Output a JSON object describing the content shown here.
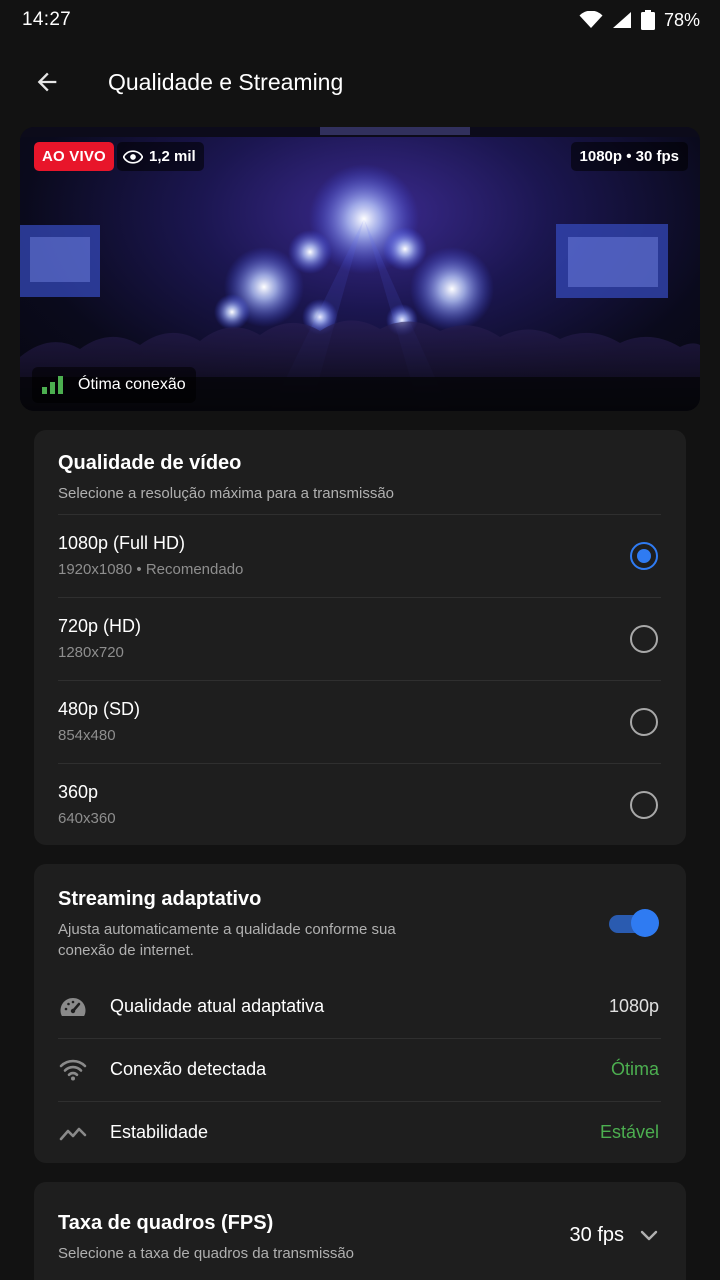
{
  "status": {
    "time": "14:27",
    "battery": "78%"
  },
  "appbar": {
    "title": "Qualidade e Streaming"
  },
  "hero": {
    "live_label": "AO VIVO",
    "viewers": "1,2 mil",
    "resolution": "1080p • 30 fps",
    "connection": "Ótima conexão"
  },
  "quality": {
    "title": "Qualidade de vídeo",
    "subtitle": "Selecione a resolução máxima para a transmissão",
    "options": [
      {
        "name": "1080p (Full HD)",
        "desc": "1920x1080 • Recomendado",
        "selected": true
      },
      {
        "name": "720p (HD)",
        "desc": "1280x720",
        "selected": false
      },
      {
        "name": "480p (SD)",
        "desc": "854x480",
        "selected": false
      },
      {
        "name": "360p",
        "desc": "640x360",
        "selected": false
      }
    ]
  },
  "adaptive": {
    "title": "Streaming adaptativo",
    "subtitle": "Ajusta automaticamente a qualidade conforme sua conexão de internet.",
    "enabled": true,
    "rows": [
      {
        "icon": "speedometer-icon",
        "label": "Qualidade atual adaptativa",
        "value": "1080p"
      },
      {
        "icon": "wifi-icon",
        "label": "Conexão detectada",
        "value": "Ótima"
      },
      {
        "icon": "trending-icon",
        "label": "Estabilidade",
        "value": "Estável"
      }
    ]
  },
  "fps": {
    "title": "Taxa de quadros (FPS)",
    "subtitle": "Selecione a taxa de quadros da transmissão",
    "value": "30 fps"
  },
  "colors": {
    "accent": "#2f7bf2",
    "live": "#e8152a",
    "good": "#4caf50",
    "background": "#121212",
    "card": "#1e1e1e"
  }
}
